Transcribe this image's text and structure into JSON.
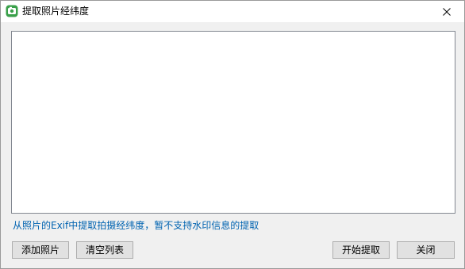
{
  "window": {
    "title": "提取照片经纬度",
    "icon": "app-photo-icon",
    "close_icon": "close-icon"
  },
  "main": {
    "photo_list_items": [],
    "hint": "从照片的Exif中提取拍摄经纬度，暂不支持水印信息的提取"
  },
  "buttons": {
    "add_photos": "添加照片",
    "clear_list": "清空列表",
    "start_extract": "开始提取",
    "close": "关闭"
  },
  "colors": {
    "hint_text": "#0063b1",
    "icon_green": "#3aa04a"
  }
}
